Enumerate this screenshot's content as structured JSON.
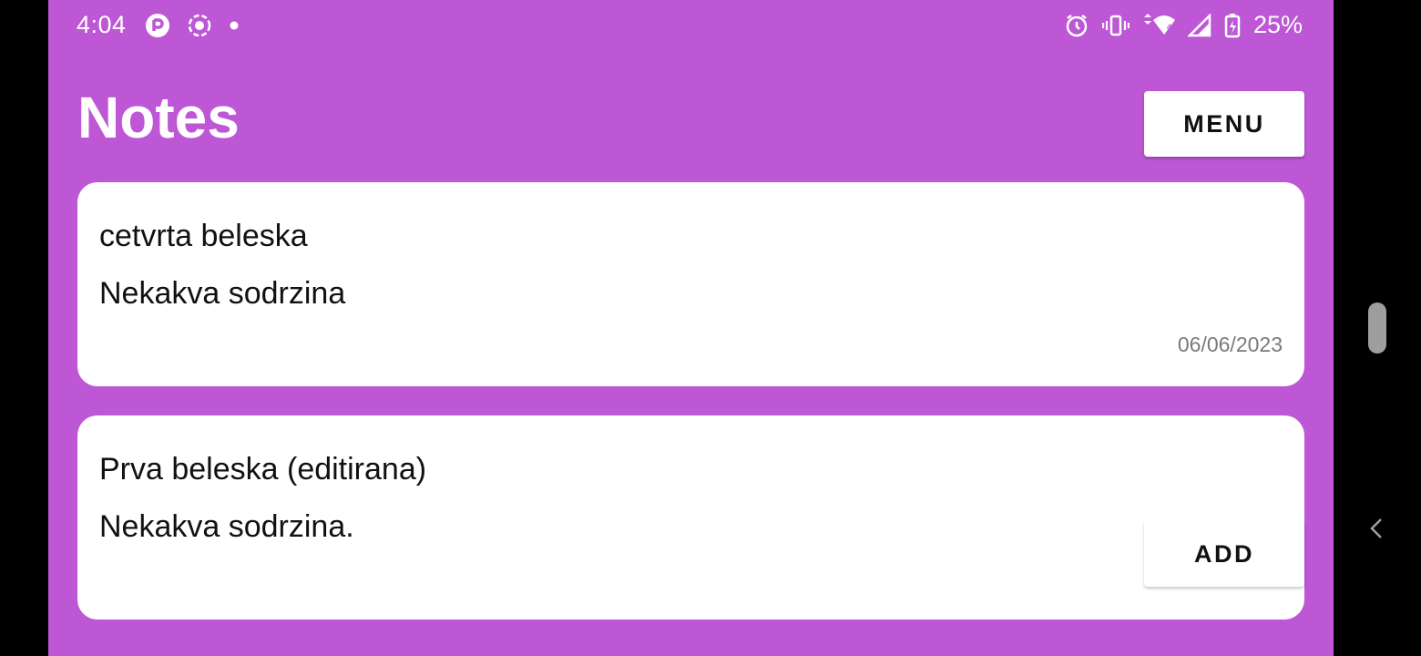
{
  "status_bar": {
    "time": "4:04",
    "battery": "25%",
    "left_icons": [
      "pocket-casts-icon",
      "screen-record-icon",
      "dot-icon"
    ],
    "right_icons": [
      "alarm-icon",
      "vibrate-icon",
      "wifi-icon",
      "signal-icon",
      "battery-charging-icon"
    ]
  },
  "header": {
    "title": "Notes",
    "menu_label": "MENU"
  },
  "notes": [
    {
      "title": "cetvrta beleska",
      "body": "Nekakva sodrzina",
      "date": "06/06/2023"
    },
    {
      "title": "Prva beleska (editirana)",
      "body": "Nekakva sodrzina."
    }
  ],
  "add_label": "ADD",
  "colors": {
    "background": "#BD57D5",
    "card": "#FFFFFF",
    "text": "#111111",
    "date": "#7A7A7A"
  }
}
